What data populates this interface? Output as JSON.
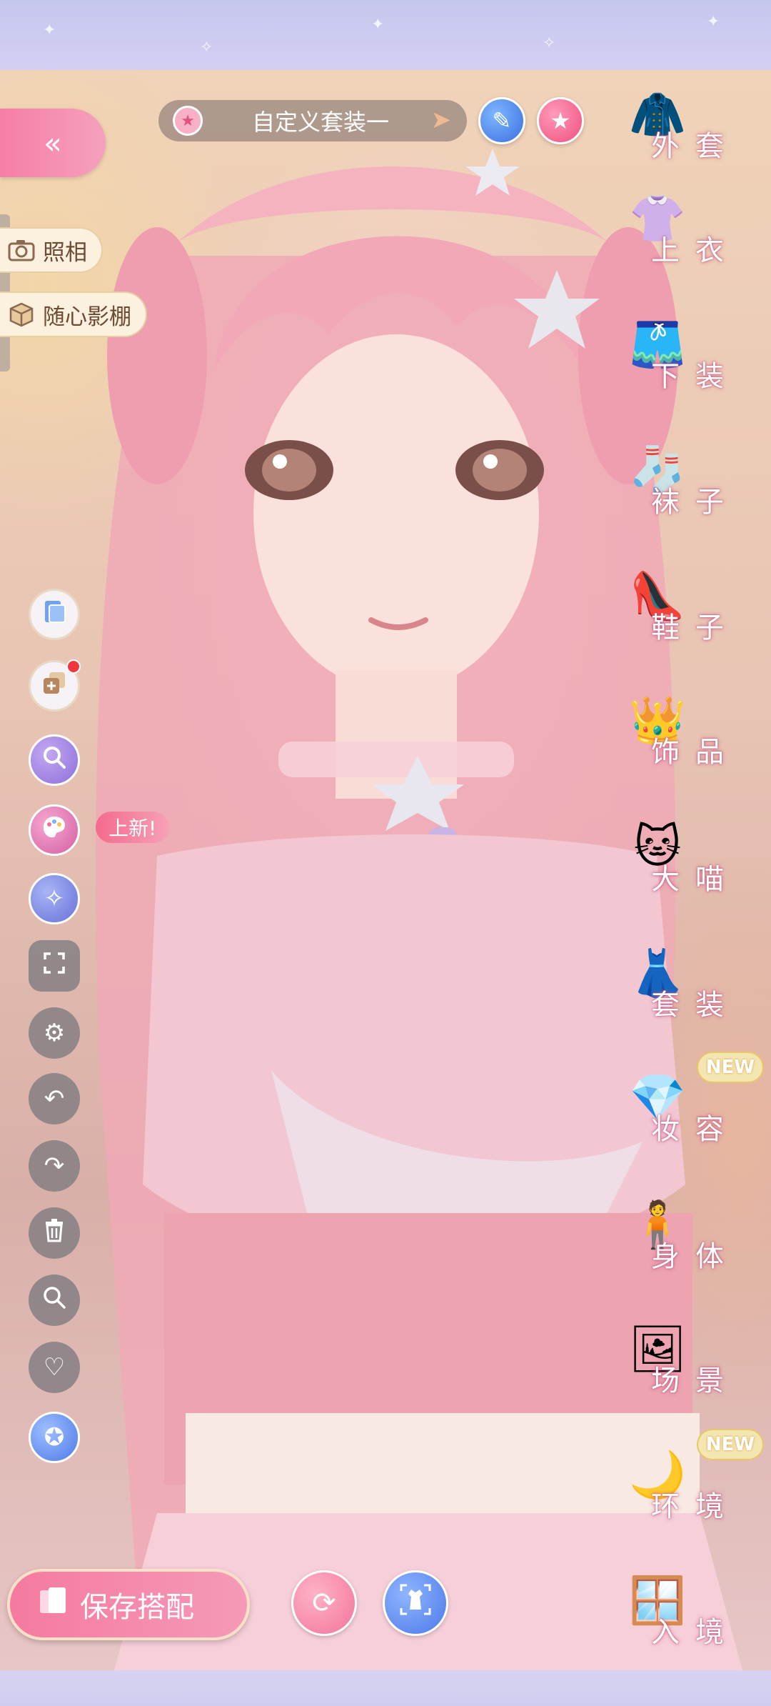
{
  "header": {
    "outfit_name": "自定义套装一"
  },
  "left_panel": {
    "photo_label": "照相",
    "studio_label": "随心影棚",
    "new_tag": "上新!"
  },
  "left_tools": [
    {
      "name": "outfit-card-tool",
      "icon": "card-icon"
    },
    {
      "name": "layer-add-tool",
      "icon": "layer-add-icon"
    },
    {
      "name": "search-swap-tool",
      "icon": "search-swap-icon"
    },
    {
      "name": "palette-tool",
      "icon": "palette-icon"
    },
    {
      "name": "star-effect-tool",
      "icon": "star-effect-icon"
    },
    {
      "name": "fullscreen-tool",
      "icon": "fullscreen-icon"
    },
    {
      "name": "settings-tool",
      "icon": "gear-icon"
    },
    {
      "name": "undo-tool",
      "icon": "undo-icon"
    },
    {
      "name": "redo-tool",
      "icon": "redo-icon"
    },
    {
      "name": "delete-tool",
      "icon": "trash-icon"
    },
    {
      "name": "zoom-tool",
      "icon": "magnifier-icon"
    },
    {
      "name": "favorite-tool",
      "icon": "heart-icon"
    },
    {
      "name": "star-badge-tool",
      "icon": "star-badge-icon"
    }
  ],
  "categories": [
    {
      "label": "外套",
      "icon": "coat-icon"
    },
    {
      "label": "上衣",
      "icon": "shirt-icon"
    },
    {
      "label": "下装",
      "icon": "shorts-icon"
    },
    {
      "label": "袜子",
      "icon": "sock-icon"
    },
    {
      "label": "鞋子",
      "icon": "shoe-icon"
    },
    {
      "label": "饰品",
      "icon": "tiara-icon"
    },
    {
      "label": "大喵",
      "icon": "cat-icon"
    },
    {
      "label": "套装",
      "icon": "outfit-set-icon"
    },
    {
      "label": "妆容",
      "icon": "gem-icon"
    },
    {
      "label": "身体",
      "icon": "body-icon"
    },
    {
      "label": "场景",
      "icon": "scene-frame-icon"
    },
    {
      "label": "环境",
      "icon": "moon-icon"
    },
    {
      "label": "入境",
      "icon": "window-icon"
    }
  ],
  "badges": {
    "makeup_new": "NEW",
    "environment_new": "NEW"
  },
  "bottom": {
    "save_label": "保存搭配"
  },
  "colors": {
    "accent_pink": "#f57aa0",
    "accent_blue": "#4c78e8",
    "frame_lavender": "#c6c7ee"
  }
}
